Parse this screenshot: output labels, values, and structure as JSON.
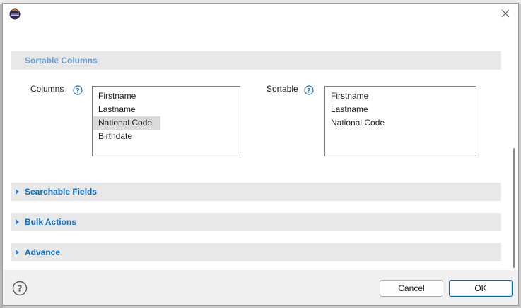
{
  "colors": {
    "section_text": "#0b6ec5",
    "section_text_expanded": "#6b9ed3",
    "section_bg": "#e8e8e8",
    "selection_bg": "#dadada",
    "primary_border": "#0067c0"
  },
  "title_bar": {
    "icon": "eclipse-icon",
    "close_icon": "close-icon"
  },
  "sections": {
    "sortable_columns": {
      "title": "Sortable Columns",
      "columns_label": "Columns",
      "sortable_label": "Sortable",
      "columns_items": [
        "Firstname",
        "Lastname",
        "National Code",
        "Birthdate"
      ],
      "selected_column": "National Code",
      "sortable_items": [
        "Firstname",
        "Lastname",
        "National Code"
      ]
    },
    "searchable_fields": {
      "title": "Searchable Fields"
    },
    "bulk_actions": {
      "title": "Bulk Actions"
    },
    "advance": {
      "title": "Advance"
    }
  },
  "footer": {
    "help_icon": "help-circle-icon",
    "cancel_label": "Cancel",
    "ok_label": "OK"
  }
}
